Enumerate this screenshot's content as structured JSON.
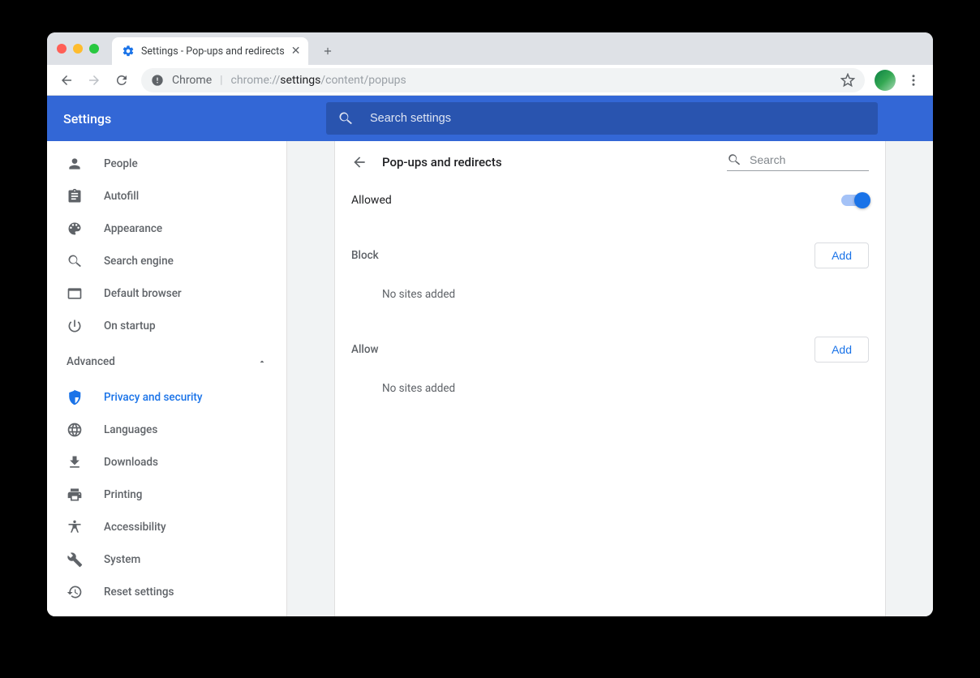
{
  "browser": {
    "tab_title": "Settings - Pop-ups and redirects",
    "omnibox_host": "Chrome",
    "url_prefix": "chrome://",
    "url_bold": "settings",
    "url_suffix": "/content/popups"
  },
  "header": {
    "title": "Settings",
    "search_placeholder": "Search settings"
  },
  "sidebar": {
    "items": [
      {
        "label": "People"
      },
      {
        "label": "Autofill"
      },
      {
        "label": "Appearance"
      },
      {
        "label": "Search engine"
      },
      {
        "label": "Default browser"
      },
      {
        "label": "On startup"
      }
    ],
    "advanced_label": "Advanced",
    "advanced_items": [
      {
        "label": "Privacy and security"
      },
      {
        "label": "Languages"
      },
      {
        "label": "Downloads"
      },
      {
        "label": "Printing"
      },
      {
        "label": "Accessibility"
      },
      {
        "label": "System"
      },
      {
        "label": "Reset settings"
      }
    ]
  },
  "page": {
    "title": "Pop-ups and redirects",
    "search_placeholder": "Search",
    "allowed_label": "Allowed",
    "allowed_state": true,
    "block": {
      "label": "Block",
      "add_label": "Add",
      "empty": "No sites added"
    },
    "allow": {
      "label": "Allow",
      "add_label": "Add",
      "empty": "No sites added"
    }
  }
}
